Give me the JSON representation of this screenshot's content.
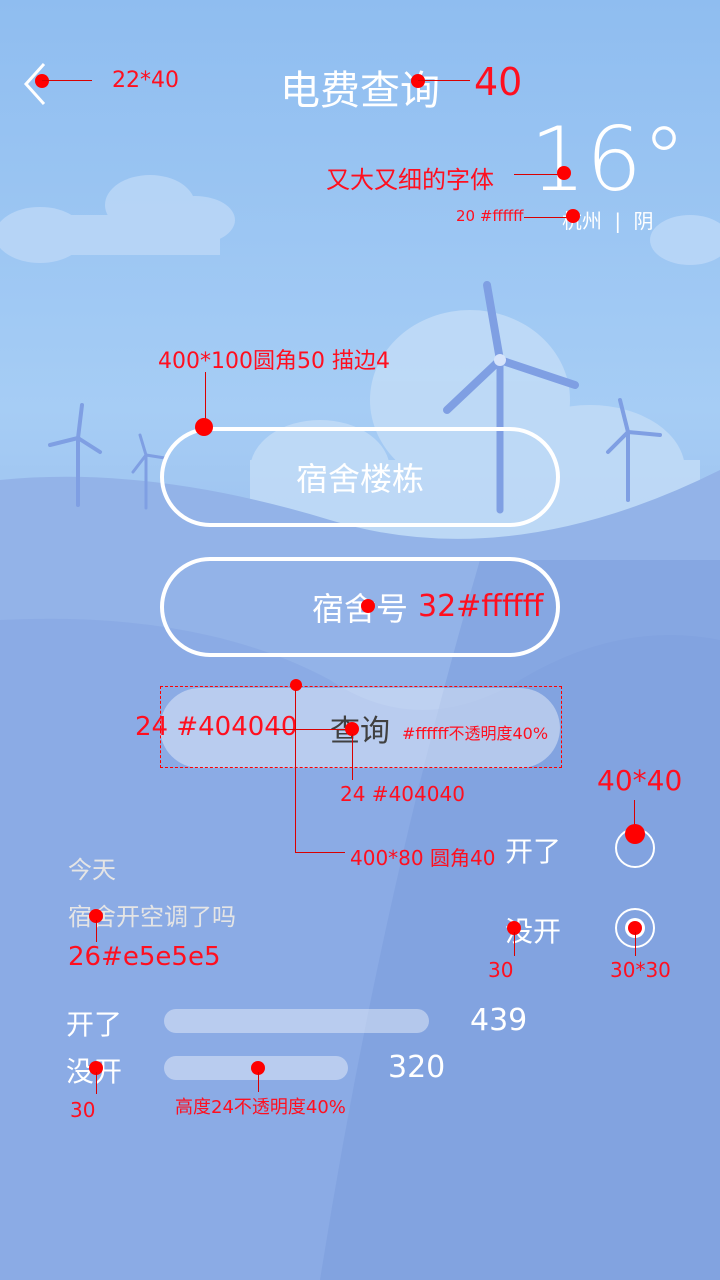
{
  "header": {
    "title": "电费查询",
    "back_icon": "chevron-left-icon"
  },
  "weather": {
    "temperature": "16°",
    "city": "杭州",
    "separator": "|",
    "condition": "阴"
  },
  "form": {
    "building_label": "宿舍楼栋",
    "room_label": "宿舍号",
    "query_label": "查询"
  },
  "survey": {
    "date_label": "今天",
    "question": "宿舍开空调了吗",
    "options": [
      {
        "label": "开了",
        "selected": false
      },
      {
        "label": "没开",
        "selected": true
      }
    ]
  },
  "stats": [
    {
      "label": "开了",
      "count": "439",
      "fraction": 0.44
    },
    {
      "label": "没开",
      "count": "320",
      "fraction": 0.31
    }
  ],
  "annotations": {
    "back_size": "22*40",
    "title_size": "40",
    "font_note": "又大又细的字体",
    "city_note": "20  #ffffff",
    "pill_spec": "400*100圆角50 描边4",
    "room_spec": "32#ffffff",
    "query_left": "24 #404040",
    "query_right": "#ffffff不透明度40%",
    "query_below": "24 #404040",
    "query_spec": "400*80 圆角40",
    "radio_size": "40*40",
    "question_spec": "26#e5e5e5",
    "option_size": "30",
    "radio_inner_size": "30*30",
    "stat_size": "30",
    "bar_spec": "高度24不透明度40%"
  },
  "colors": {
    "text": "#ffffff",
    "query_text": "#404040",
    "annotation": "#ff0000"
  }
}
